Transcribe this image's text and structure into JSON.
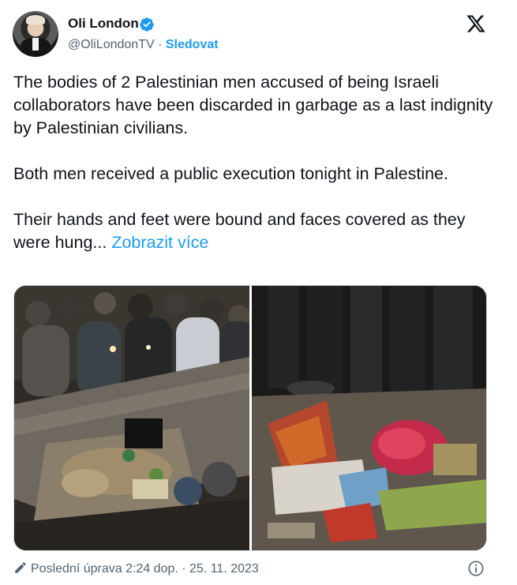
{
  "author": {
    "name": "Oli London",
    "handle": "@OliLondonTV",
    "separator": "·",
    "follow_label": "Sledovat",
    "verified_icon": "verified-badge-icon",
    "avatar_icon": "profile-avatar"
  },
  "brand": {
    "logo_icon": "x-logo-icon"
  },
  "tweet": {
    "paragraphs": [
      "The bodies of 2 Palestinian men accused of being Israeli collaborators have been discarded in garbage as a last indignity by Palestinian civilians.",
      "Both men received a public execution tonight in Palestine.",
      "Their hands and feet were bound and faces covered as they were hung..."
    ],
    "show_more_label": "Zobrazit více"
  },
  "footer": {
    "edited_label": "Poslední úprava 2:24 dop. · 25. 11. 2023",
    "edit_icon": "pencil-icon",
    "info_icon": "info-icon"
  },
  "colors": {
    "accent": "#1d9bf0",
    "text": "#0f1419",
    "secondary": "#536471",
    "border": "#cfd9de"
  }
}
